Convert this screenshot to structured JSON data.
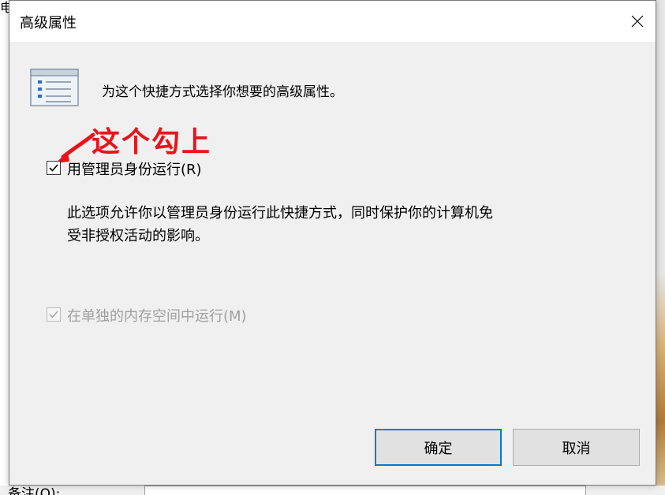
{
  "background": {
    "left_text": "电",
    "remark_label": "备注(O):"
  },
  "dialog": {
    "title": "高级属性",
    "header_text": "为这个快捷方式选择你想要的高级属性。",
    "annotation": "这个勾上",
    "run_as_admin": {
      "label": "用管理员身份运行(R)",
      "checked": true
    },
    "description_lines": [
      "此选项允许你以管理员身份运行此快捷方式，同时保护你的计算机免",
      "受非授权活动的影响。"
    ],
    "separate_memory": {
      "label": "在单独的内存空间中运行(M)",
      "checked": true,
      "disabled": true
    },
    "ok_label": "确定",
    "cancel_label": "取消"
  },
  "colors": {
    "annotation": "#e8141b",
    "default_button_border": "#0078d7"
  },
  "icons": {
    "close": "close-icon",
    "properties": "properties-list-icon",
    "arrow": "red-arrow-icon",
    "check": "checkmark-icon"
  }
}
